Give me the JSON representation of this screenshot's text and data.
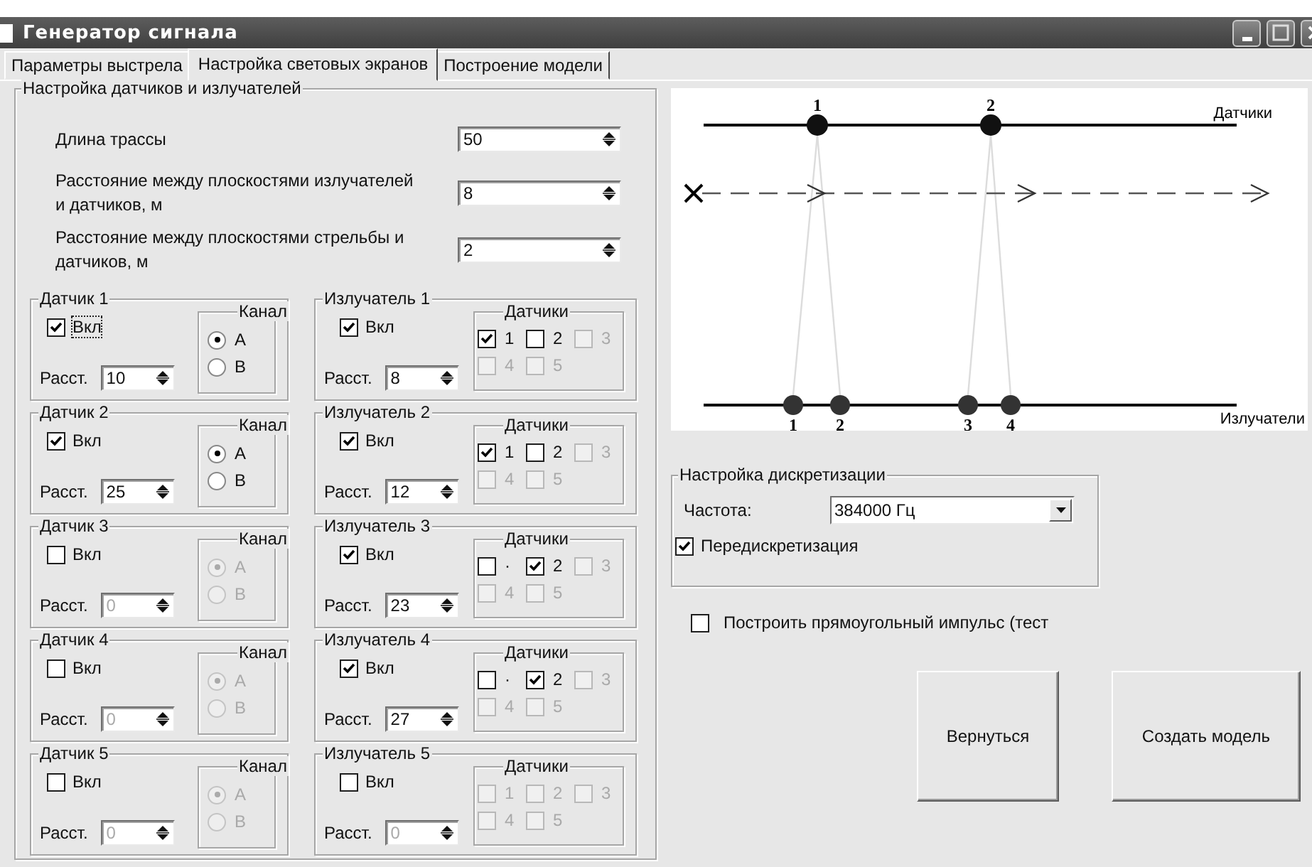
{
  "window": {
    "title": "Генератор сигнала"
  },
  "tabs": [
    {
      "label": "Параметры выстрела",
      "selected": false
    },
    {
      "label": "Настройка световых экранов",
      "selected": true
    },
    {
      "label": "Построение модели",
      "selected": false
    }
  ],
  "sensor_setup": {
    "title": "Настройка датчиков и излучателей",
    "fields": [
      {
        "label": "Длина трассы",
        "value": "50"
      },
      {
        "label": "Расстояние между плоскостями излучателей и датчиков, м",
        "value": "8"
      },
      {
        "label": "Расстояние между плоскостями стрельбы и датчиков, м",
        "value": "2"
      }
    ],
    "sensors": [
      {
        "title": "Датчик 1",
        "on_label": "Вкл",
        "on": true,
        "focused": true,
        "distance_label": "Расст.",
        "distance": "10",
        "channel_title": "Канал",
        "channels": [
          {
            "label": "A",
            "selected": true
          },
          {
            "label": "B",
            "selected": false
          }
        ]
      },
      {
        "title": "Датчик 2",
        "on_label": "Вкл",
        "on": true,
        "focused": false,
        "distance_label": "Расст.",
        "distance": "25",
        "channel_title": "Канал",
        "channels": [
          {
            "label": "A",
            "selected": true
          },
          {
            "label": "B",
            "selected": false
          }
        ]
      },
      {
        "title": "Датчик 3",
        "on_label": "Вкл",
        "on": false,
        "focused": false,
        "distance_label": "Расст.",
        "distance": "0",
        "channel_title": "Канал",
        "channels": [
          {
            "label": "A",
            "selected": true
          },
          {
            "label": "B",
            "selected": false
          }
        ]
      },
      {
        "title": "Датчик 4",
        "on_label": "Вкл",
        "on": false,
        "focused": false,
        "distance_label": "Расст.",
        "distance": "0",
        "channel_title": "Канал",
        "channels": [
          {
            "label": "A",
            "selected": true
          },
          {
            "label": "B",
            "selected": false
          }
        ]
      },
      {
        "title": "Датчик 5",
        "on_label": "Вкл",
        "on": false,
        "focused": false,
        "distance_label": "Расст.",
        "distance": "0",
        "channel_title": "Канал",
        "channels": [
          {
            "label": "A",
            "selected": true
          },
          {
            "label": "B",
            "selected": false
          }
        ]
      }
    ],
    "emitters": [
      {
        "title": "Излучатель 1",
        "on_label": "Вкл",
        "on": true,
        "distance_label": "Расст.",
        "distance": "8",
        "sensors_title": "Датчики",
        "sensors": [
          {
            "label": "1",
            "checked": true,
            "disabled": false
          },
          {
            "label": "2",
            "checked": false,
            "disabled": false
          },
          {
            "label": "3",
            "checked": false,
            "disabled": true
          },
          {
            "label": "4",
            "checked": false,
            "disabled": true
          },
          {
            "label": "5",
            "checked": false,
            "disabled": true
          }
        ]
      },
      {
        "title": "Излучатель 2",
        "on_label": "Вкл",
        "on": true,
        "distance_label": "Расст.",
        "distance": "12",
        "sensors_title": "Датчики",
        "sensors": [
          {
            "label": "1",
            "checked": true,
            "disabled": false
          },
          {
            "label": "2",
            "checked": false,
            "disabled": false
          },
          {
            "label": "3",
            "checked": false,
            "disabled": true
          },
          {
            "label": "4",
            "checked": false,
            "disabled": true
          },
          {
            "label": "5",
            "checked": false,
            "disabled": true
          }
        ]
      },
      {
        "title": "Излучатель 3",
        "on_label": "Вкл",
        "on": true,
        "distance_label": "Расст.",
        "distance": "23",
        "sensors_title": "Датчики",
        "sensors": [
          {
            "label": "·",
            "checked": false,
            "disabled": false
          },
          {
            "label": "2",
            "checked": true,
            "disabled": false
          },
          {
            "label": "3",
            "checked": false,
            "disabled": true
          },
          {
            "label": "4",
            "checked": false,
            "disabled": true
          },
          {
            "label": "5",
            "checked": false,
            "disabled": true
          }
        ]
      },
      {
        "title": "Излучатель 4",
        "on_label": "Вкл",
        "on": true,
        "distance_label": "Расст.",
        "distance": "27",
        "sensors_title": "Датчики",
        "sensors": [
          {
            "label": "·",
            "checked": false,
            "disabled": false
          },
          {
            "label": "2",
            "checked": true,
            "disabled": false
          },
          {
            "label": "3",
            "checked": false,
            "disabled": true
          },
          {
            "label": "4",
            "checked": false,
            "disabled": true
          },
          {
            "label": "5",
            "checked": false,
            "disabled": true
          }
        ]
      },
      {
        "title": "Излучатель 5",
        "on_label": "Вкл",
        "on": false,
        "distance_label": "Расст.",
        "distance": "0",
        "sensors_title": "Датчики",
        "sensors": [
          {
            "label": "1",
            "checked": false,
            "disabled": true
          },
          {
            "label": "2",
            "checked": false,
            "disabled": true
          },
          {
            "label": "3",
            "checked": false,
            "disabled": true
          },
          {
            "label": "4",
            "checked": false,
            "disabled": true
          },
          {
            "label": "5",
            "checked": false,
            "disabled": true
          }
        ]
      }
    ]
  },
  "diagram": {
    "sensor_line_label": "Датчики",
    "emitter_line_label": "Излучатели",
    "sensor_labels": [
      "1",
      "2"
    ],
    "emitter_labels": [
      "1",
      "2",
      "3",
      "4"
    ]
  },
  "sampling": {
    "title": "Настройка дискретизации",
    "frequency_label": "Частота:",
    "frequency": "384000 Гц",
    "resample_label": "Передискретизация",
    "resample": true
  },
  "pulse": {
    "label": "Построить прямоугольный импульс (тест",
    "checked": false
  },
  "buttons": [
    "Вернуться",
    "Создать модель"
  ]
}
